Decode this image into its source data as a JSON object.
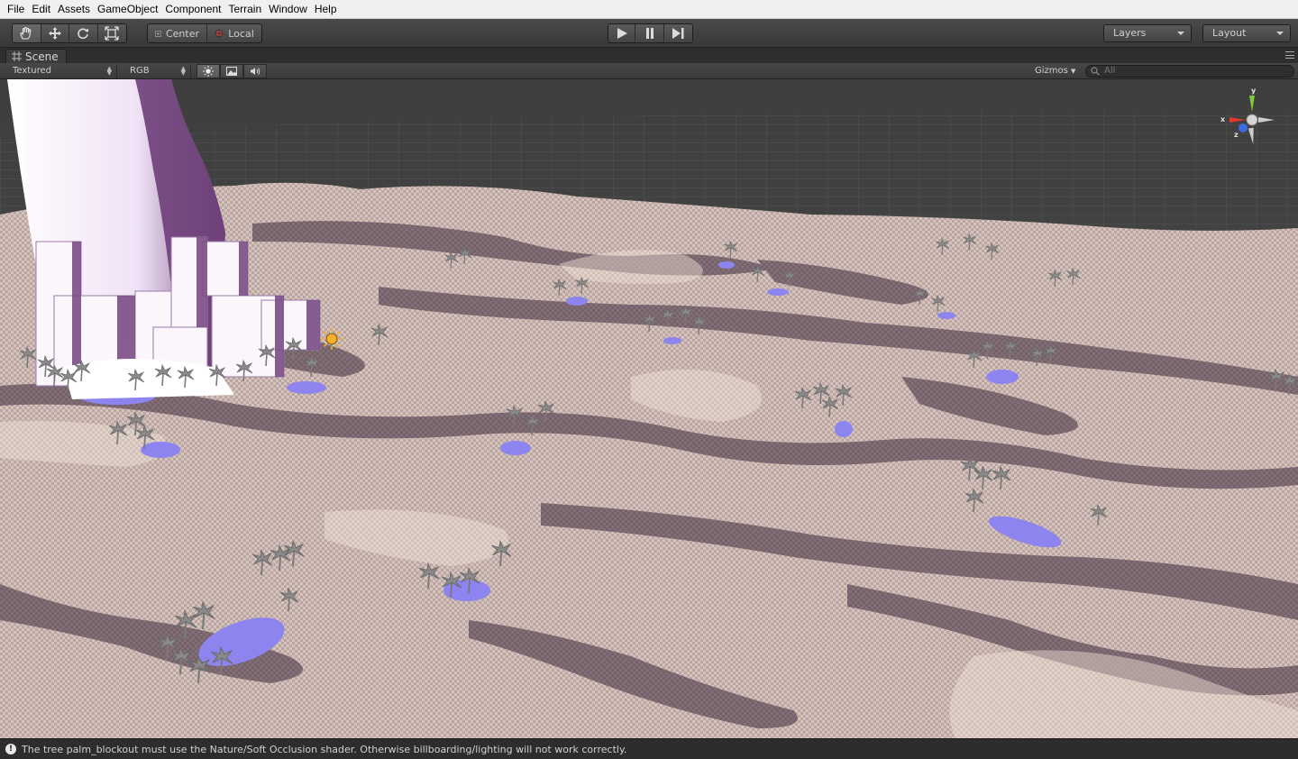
{
  "menubar": {
    "items": [
      {
        "label": "File"
      },
      {
        "label": "Edit"
      },
      {
        "label": "Assets"
      },
      {
        "label": "GameObject"
      },
      {
        "label": "Component"
      },
      {
        "label": "Terrain"
      },
      {
        "label": "Window"
      },
      {
        "label": "Help"
      }
    ]
  },
  "toolbar": {
    "tools": [
      "hand-icon",
      "move-icon",
      "rotate-icon",
      "scale-icon"
    ],
    "pivot_label": "Center",
    "space_label": "Local",
    "play_icons": [
      "play-icon",
      "pause-icon",
      "step-icon"
    ],
    "layers_label": "Layers",
    "layout_label": "Layout"
  },
  "scene_tab": {
    "title": "Scene"
  },
  "scene_toolbar": {
    "render_mode": "Textured",
    "color_mode": "RGB",
    "toggles": [
      "lighting-icon",
      "image-effects-icon",
      "audio-icon"
    ],
    "gizmos_label": "Gizmos",
    "search_placeholder": "All"
  },
  "axis_gizmo": {
    "x_label": "x",
    "y_label": "y",
    "z_label": "z",
    "colors": {
      "x": "#e03a2a",
      "y": "#7ec83a",
      "z": "#3a6ee0"
    }
  },
  "status": {
    "message": "The tree palm_blockout must use the Nature/Soft Occlusion shader. Otherwise billboarding/lighting will not work correctly."
  },
  "colors": {
    "terrain_light": "#d9c8c0",
    "terrain_dark": "#3e2a3e",
    "water": "#8d84f0",
    "building": "#f2e6f6",
    "trees": "#8a8a8a"
  }
}
